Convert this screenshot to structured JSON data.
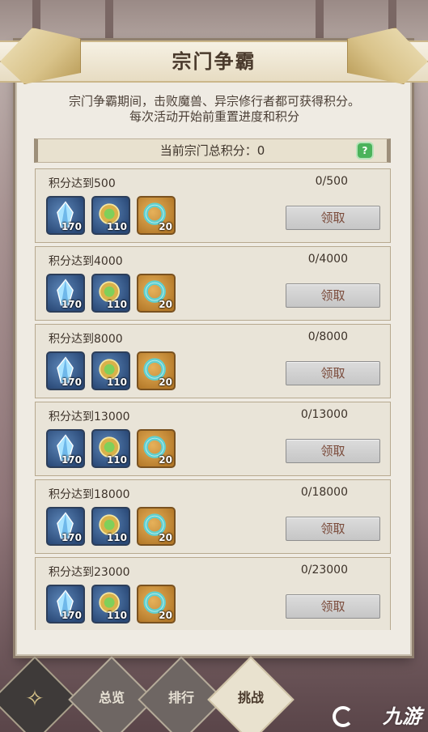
{
  "header": {
    "title": "宗门争霸"
  },
  "description": {
    "line1": "宗门争霸期间，击败魔兽、异宗修行者都可获得积分。",
    "line2": "每次活动开始前重置进度和积分"
  },
  "total": {
    "label": "当前宗门总积分：0",
    "help_icon": "question-shield-icon"
  },
  "claim_label": "领取",
  "rewards_common": [
    {
      "icon": "crystal-icon",
      "qty": "170",
      "style": "blue"
    },
    {
      "icon": "gem-medallion-icon",
      "qty": "110",
      "style": "blue"
    },
    {
      "icon": "jade-ring-icon",
      "qty": "20",
      "style": "gold"
    }
  ],
  "tiers": [
    {
      "label": "积分达到500",
      "progress": "0/500"
    },
    {
      "label": "积分达到4000",
      "progress": "0/4000"
    },
    {
      "label": "积分达到8000",
      "progress": "0/8000"
    },
    {
      "label": "积分达到13000",
      "progress": "0/13000"
    },
    {
      "label": "积分达到18000",
      "progress": "0/18000"
    },
    {
      "label": "积分达到23000",
      "progress": "0/23000"
    }
  ],
  "tabs": [
    {
      "label": "总览"
    },
    {
      "label": "排行"
    },
    {
      "label": "挑战"
    }
  ],
  "watermark": "九游",
  "colors": {
    "accent_gold": "#d9c38a",
    "help_green": "#4bb35b"
  }
}
